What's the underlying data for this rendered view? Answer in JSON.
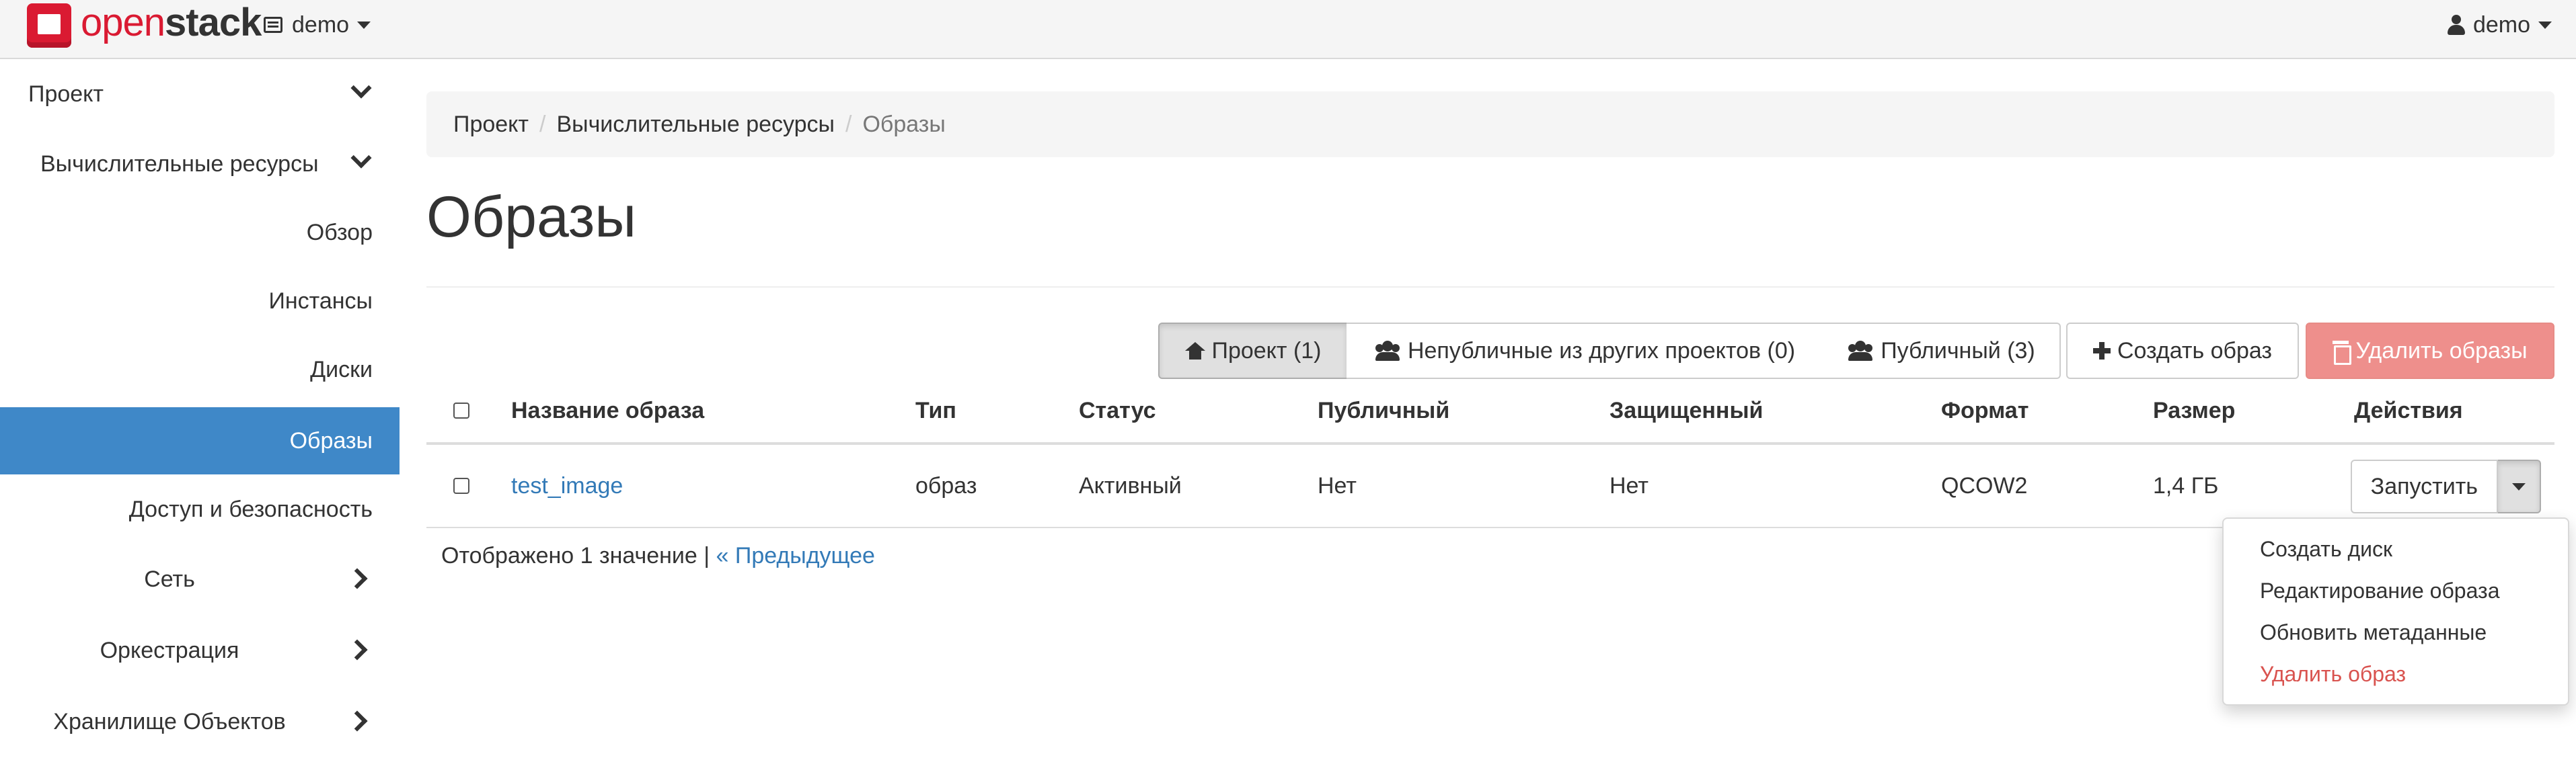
{
  "brand": {
    "part1": "open",
    "part2": "stack"
  },
  "topbar": {
    "project": "demo",
    "user": "demo"
  },
  "sidebar": [
    {
      "label": "Проект",
      "chevron": "down"
    },
    {
      "label": "Вычислительные ресурсы",
      "chevron": "down"
    },
    {
      "label": "Обзор"
    },
    {
      "label": "Инстансы"
    },
    {
      "label": "Диски"
    },
    {
      "label": "Образы",
      "active": true
    },
    {
      "label": "Доступ и безопасность"
    },
    {
      "label": "Сеть",
      "chevron": "right"
    },
    {
      "label": "Оркестрация",
      "chevron": "right"
    },
    {
      "label": "Хранилище Объектов",
      "chevron": "right"
    }
  ],
  "breadcrumb": {
    "item1": "Проект",
    "item2": "Вычислительные ресурсы",
    "current": "Образы",
    "separator": "/"
  },
  "page": {
    "title": "Образы"
  },
  "filters": {
    "project": "Проект (1)",
    "shared": "Непубличные из других проектов (0)",
    "public": "Публичный (3)",
    "create": "Создать образ",
    "delete": "Удалить образы"
  },
  "table": {
    "headers": {
      "name": "Название образа",
      "type": "Тип",
      "status": "Статус",
      "public": "Публичный",
      "protected": "Защищенный",
      "format": "Формат",
      "size": "Размер",
      "actions": "Действия"
    },
    "rows": [
      {
        "name": "test_image",
        "type": "образ",
        "status": "Активный",
        "public": "Нет",
        "protected": "Нет",
        "format": "QCOW2",
        "size": "1,4 ГБ",
        "action": "Запустить"
      }
    ]
  },
  "footer": {
    "count": "Отображено 1 значение |",
    "prev": "« Предыдущее"
  },
  "dropdown": [
    {
      "label": "Создать диск"
    },
    {
      "label": "Редактирование образа"
    },
    {
      "label": "Обновить метаданные"
    },
    {
      "label": "Удалить образ",
      "danger": true
    }
  ],
  "colors": {
    "accent": "#3f88c8",
    "danger": "#d9534f",
    "brand": "#da1a32"
  }
}
